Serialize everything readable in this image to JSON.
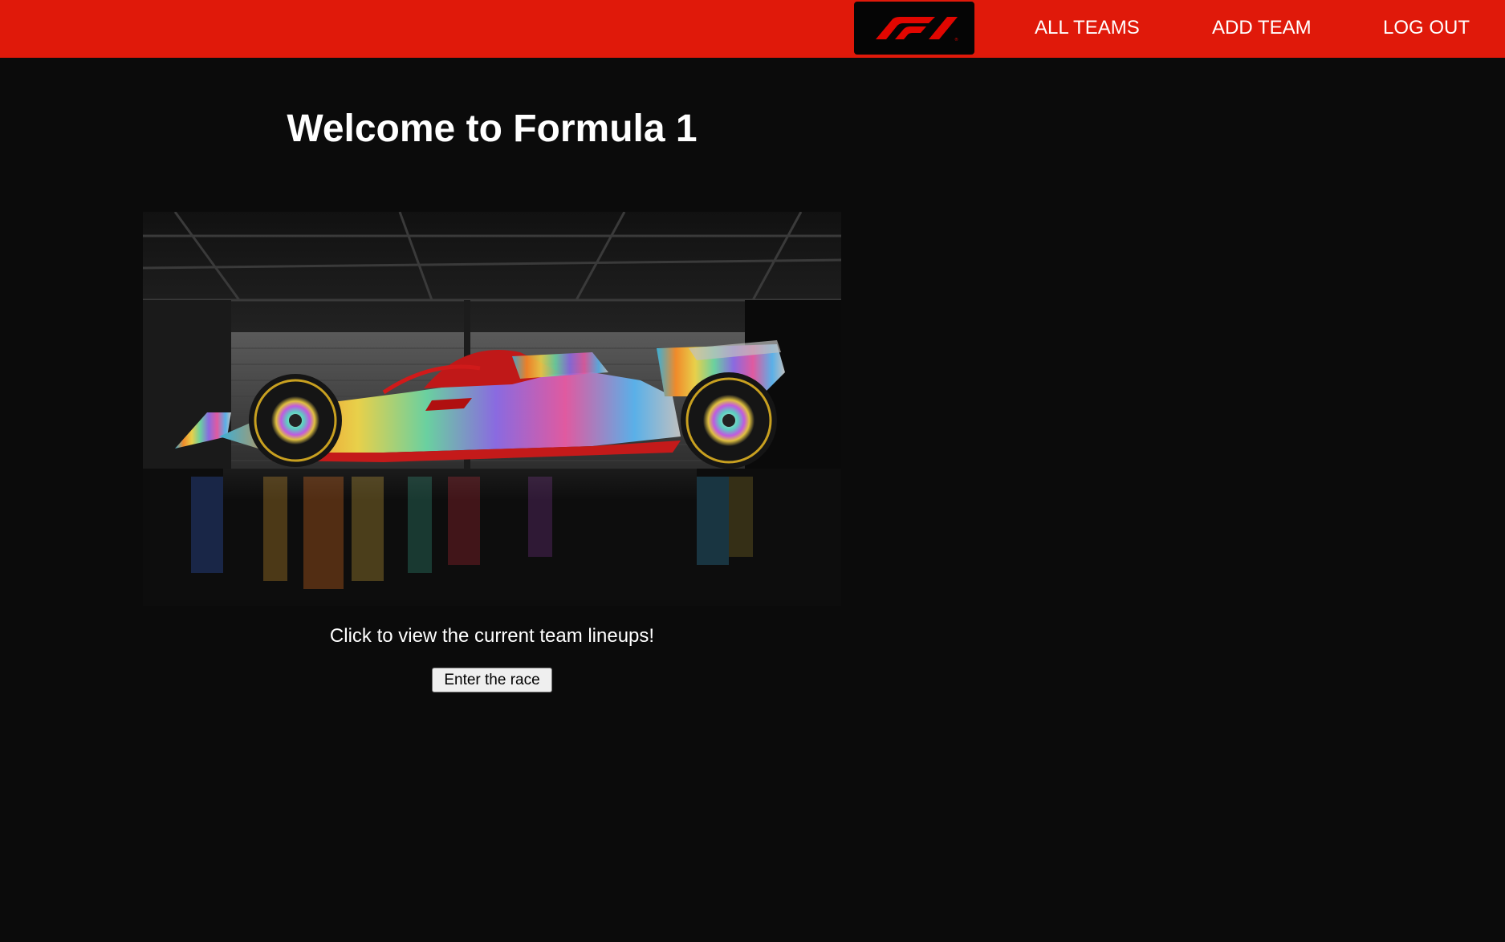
{
  "nav": {
    "logo_alt": "F1",
    "links": [
      {
        "label": "ALL TEAMS"
      },
      {
        "label": "ADD TEAM"
      },
      {
        "label": "LOG OUT"
      }
    ]
  },
  "main": {
    "title": "Welcome to Formula 1",
    "image_alt": "Formula 1 car",
    "tagline": "Click to view the current team lineups!",
    "button_label": "Enter the race"
  },
  "colors": {
    "navbar": "#e0190a",
    "background": "#0b0b0b",
    "logo_bg": "#050505",
    "text": "#ffffff"
  }
}
